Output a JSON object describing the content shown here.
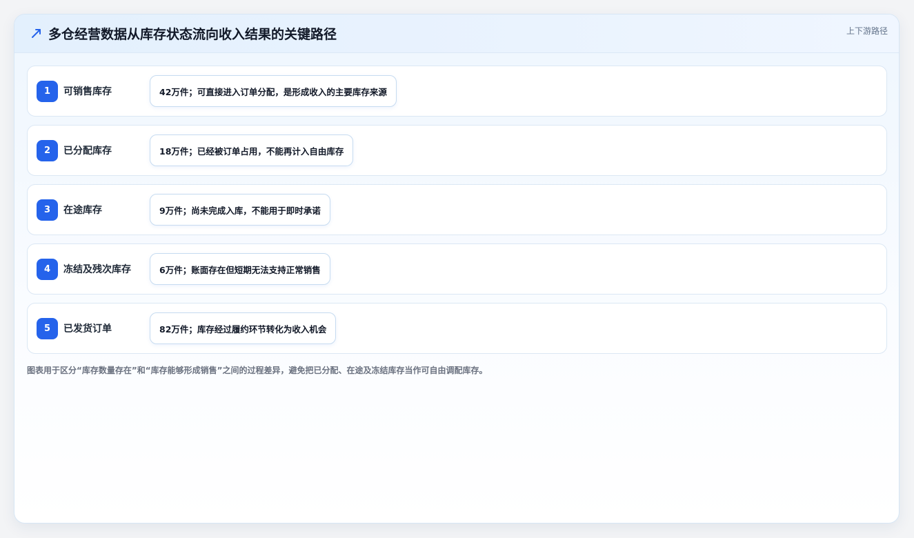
{
  "header": {
    "title": "多仓经营数据从库存状态流向收入结果的关键路径",
    "tag": "上下游路径",
    "icon": "trend-arrow-icon",
    "accent": "#2563eb"
  },
  "steps": [
    {
      "number": "1",
      "label": "可销售库存",
      "detail": "42万件；可直接进入订单分配，是形成收入的主要库存来源"
    },
    {
      "number": "2",
      "label": "已分配库存",
      "detail": "18万件；已经被订单占用，不能再计入自由库存"
    },
    {
      "number": "3",
      "label": "在途库存",
      "detail": "9万件；尚未完成入库，不能用于即时承诺"
    },
    {
      "number": "4",
      "label": "冻结及残次库存",
      "detail": "6万件；账面存在但短期无法支持正常销售"
    },
    {
      "number": "5",
      "label": "已发货订单",
      "detail": "82万件；库存经过履约环节转化为收入机会"
    }
  ],
  "footnote": "图表用于区分“库存数量存在”和“库存能够形成销售”之间的过程差异，避免把已分配、在途及冻结库存当作可自由调配库存。"
}
